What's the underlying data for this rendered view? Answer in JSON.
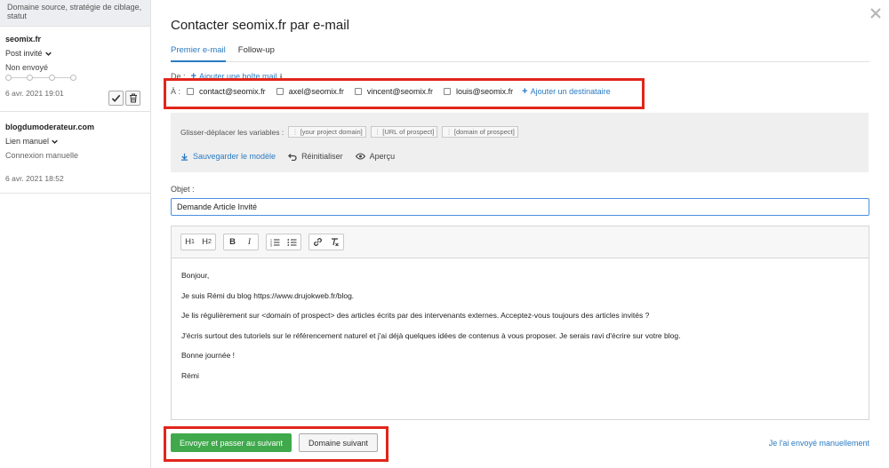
{
  "sidebar": {
    "hint": "Domaine source, stratégie de ciblage, statut",
    "cards": [
      {
        "domain": "seomix.fr",
        "type": "Post invité",
        "status": "Non envoyé",
        "date": "6 avr. 2021 19:01"
      },
      {
        "domain": "blogdumoderateur.com",
        "type": "Lien manuel",
        "status": "Connexion manuelle",
        "date": "6 avr. 2021 18:52"
      }
    ]
  },
  "modal": {
    "title": "Contacter seomix.fr par e-mail",
    "tabs": [
      {
        "label": "Premier e-mail",
        "active": true
      },
      {
        "label": "Follow-up",
        "active": false
      }
    ],
    "from": {
      "label": "De :",
      "add_mailbox": "Ajouter une boîte mail",
      "info_icon": "info-icon"
    },
    "to": {
      "label": "À :",
      "recipients": [
        "contact@seomix.fr",
        "axel@seomix.fr",
        "vincent@seomix.fr",
        "louis@seomix.fr"
      ],
      "add_recipient": "Ajouter un destinataire"
    },
    "variables": {
      "label": "Glisser-déplacer les variables :",
      "chips": [
        "[your project domain]",
        "[URL of prospect]",
        "[domain of prospect]"
      ]
    },
    "tools": {
      "save": "Sauvegarder le modèle",
      "reset": "Réinitialiser",
      "preview": "Aperçu"
    },
    "subject": {
      "label": "Objet :",
      "value": "Demande Article Invité"
    },
    "editor": {
      "toolbar": [
        "H1",
        "H2",
        "B",
        "I",
        "ordered-list",
        "bullet-list",
        "link",
        "clear-format"
      ],
      "paragraphs": [
        "Bonjour,",
        "Je suis Rémi du blog https://www.drujokweb.fr/blog.",
        "Je lis régulièrement sur <domain of prospect> des articles écrits par des intervenants externes. Acceptez-vous toujours des articles invités ?",
        "J'écris surtout des tutoriels sur le référencement naturel et j'ai déjà quelques idées de contenus à vous proposer. Je serais ravi d'écrire sur votre blog.",
        "Bonne journée !",
        "Rémi"
      ]
    },
    "footer": {
      "send_next": "Envoyer et passer au suivant",
      "next_domain": "Domaine suivant",
      "sent_manually": "Je l'ai envoyé manuellement"
    }
  },
  "colors": {
    "accent": "#2a7bc1",
    "primary_button": "#3fa94b",
    "highlight": "#e1251b"
  }
}
